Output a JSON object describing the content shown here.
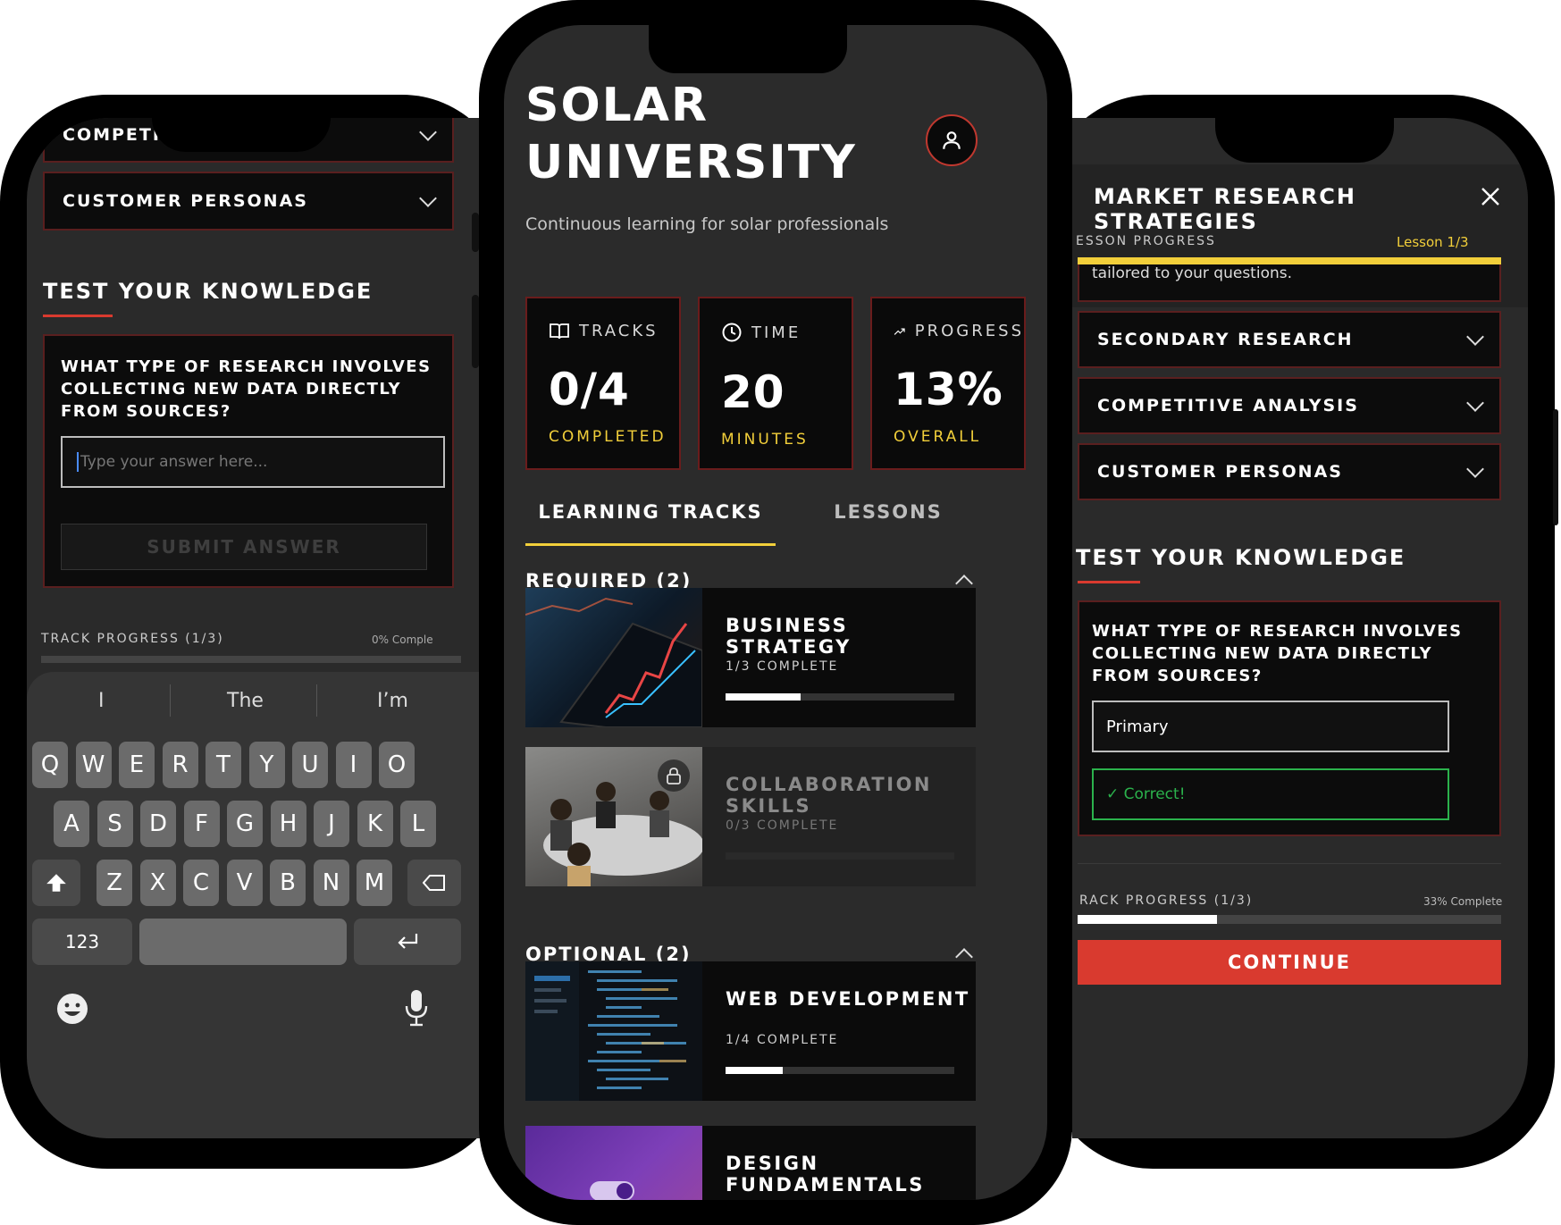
{
  "left": {
    "accordion": [
      {
        "label": "COMPETITI"
      },
      {
        "label": "CUSTOMER PERSONAS"
      }
    ],
    "quiz_title": "TEST YOUR KNOWLEDGE",
    "question": "WHAT TYPE OF RESEARCH INVOLVES COLLECTING NEW DATA DIRECTLY FROM SOURCES?",
    "answer_placeholder": "Type your answer here...",
    "submit_label": "SUBMIT ANSWER",
    "track_progress_label": "TRACK PROGRESS (1/3)",
    "track_progress_value": "0% Comple",
    "keyboard": {
      "suggestions": [
        "I",
        "The",
        "I’m"
      ],
      "row1": [
        "Q",
        "W",
        "E",
        "R",
        "T",
        "Y",
        "U",
        "I",
        "O"
      ],
      "row2": [
        "A",
        "S",
        "D",
        "F",
        "G",
        "H",
        "J",
        "K",
        "L"
      ],
      "row3": [
        "Z",
        "X",
        "C",
        "V",
        "B",
        "N",
        "M"
      ],
      "numbers_label": "123"
    }
  },
  "center": {
    "title_line1": "SOLAR",
    "title_line2": "UNIVERSITY",
    "subtitle": "Continuous learning for solar professionals",
    "stats": [
      {
        "label": "TRACKS",
        "value": "0/4",
        "sub": "COMPLETED",
        "icon": "book-icon"
      },
      {
        "label": "TIME",
        "value": "20",
        "sub": "MINUTES",
        "icon": "clock-icon"
      },
      {
        "label": "PROGRESS",
        "value": "13%",
        "sub": "OVERALL",
        "icon": "trending-up-icon"
      }
    ],
    "tabs": [
      {
        "label": "LEARNING TRACKS",
        "active": true
      },
      {
        "label": "LESSONS",
        "active": false
      }
    ],
    "required_header": "REQUIRED (2)",
    "optional_header": "OPTIONAL (2)",
    "required_tracks": [
      {
        "name": "BUSINESS STRATEGY",
        "progress_text": "1/3 COMPLETE",
        "progress": 0.33,
        "locked": false
      },
      {
        "name": "COLLABORATION SKILLS",
        "progress_text": "0/3 COMPLETE",
        "progress": 0,
        "locked": true
      }
    ],
    "optional_tracks": [
      {
        "name": "WEB DEVELOPMENT",
        "progress_text": "1/4 COMPLETE",
        "progress": 0.25,
        "locked": false
      },
      {
        "name": "DESIGN FUNDAMENTALS",
        "progress_text": "",
        "progress": 0,
        "locked": false
      }
    ]
  },
  "right": {
    "lesson_title": "MARKET RESEARCH STRATEGIES",
    "lesson_progress_label": "ESSON PROGRESS",
    "lesson_progress_value": "Lesson 1/3",
    "lesson_progress": 1.0,
    "snippet": "tailored to your questions.",
    "accordion": [
      {
        "label": "SECONDARY RESEARCH"
      },
      {
        "label": "COMPETITIVE ANALYSIS"
      },
      {
        "label": "CUSTOMER PERSONAS"
      }
    ],
    "quiz_title": "TEST YOUR KNOWLEDGE",
    "question": "WHAT TYPE OF RESEARCH INVOLVES COLLECTING NEW DATA DIRECTLY FROM SOURCES?",
    "answer_value": "Primary",
    "feedback": "✓ Correct!",
    "track_progress_label": "RACK PROGRESS (1/3)",
    "track_progress_value": "33% Complete",
    "track_progress": 0.33,
    "continue_label": "CONTINUE"
  },
  "colors": {
    "accent_red": "#d93a2f",
    "accent_yellow": "#f2cf3a",
    "success_green": "#2bb24c"
  }
}
